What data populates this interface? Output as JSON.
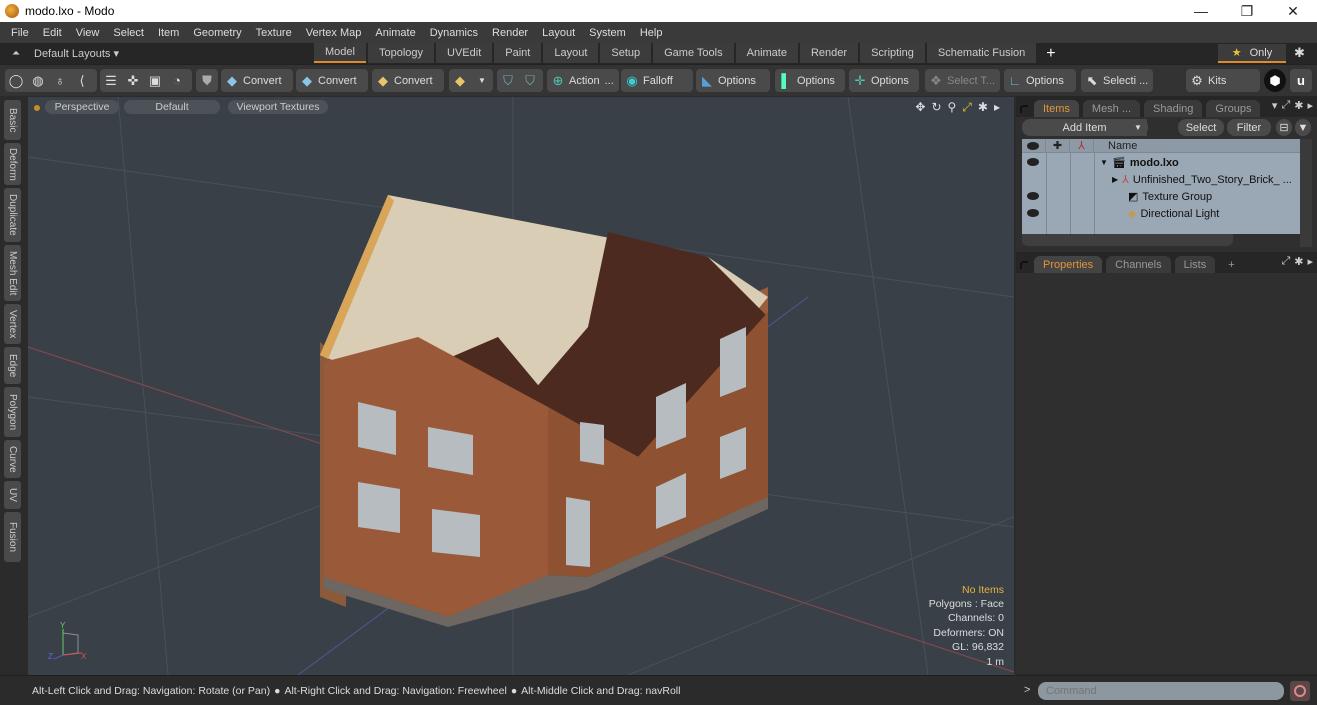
{
  "window": {
    "title": "modo.lxo - Modo",
    "minimize": "—",
    "restore": "❐",
    "close": "✕"
  },
  "menu": [
    "File",
    "Edit",
    "View",
    "Select",
    "Item",
    "Geometry",
    "Texture",
    "Vertex Map",
    "Animate",
    "Dynamics",
    "Render",
    "Layout",
    "System",
    "Help"
  ],
  "layouts": {
    "label": "Default Layouts ▾",
    "tabs": [
      "Model",
      "Topology",
      "UVEdit",
      "Paint",
      "Layout",
      "Setup",
      "Game Tools",
      "Animate",
      "Render",
      "Scripting",
      "Schematic Fusion"
    ],
    "active_tab": "Model",
    "add": "+",
    "only_label": "Only",
    "star": "★",
    "gear": "✱"
  },
  "toolbar": {
    "convert_1": "Convert",
    "convert_2": "Convert",
    "convert_3": "Convert",
    "action": "Action",
    "action_more": "...",
    "falloff": "Falloff",
    "options_1": "Options",
    "options_2": "Options",
    "options_3": "Options",
    "select_t": "Select T...",
    "options_4": "Options",
    "selecti": "Selecti ...",
    "kits": "Kits"
  },
  "side_tabs": [
    "Basic",
    "Deform",
    "Duplicate",
    "Mesh Edit",
    "Vertex",
    "Edge",
    "Polygon",
    "Curve",
    "UV",
    "Fusion"
  ],
  "viewport": {
    "view": "Perspective",
    "shading": "Default",
    "textures": "Viewport Textures",
    "stats": {
      "selection": "No Items",
      "polygons": "Polygons : Face",
      "channels": "Channels: 0",
      "deformers": "Deformers: ON",
      "gl": "GL: 96,832",
      "scale": "1 m"
    },
    "axis_y": "Y",
    "axis_x": "X",
    "axis_z": "Z"
  },
  "status_bar": {
    "hint_1": "Alt-Left Click and Drag: Navigation: Rotate (or Pan)",
    "hint_2": "Alt-Right Click and Drag: Navigation: Freewheel",
    "hint_3": "Alt-Middle Click and Drag: navRoll",
    "bullet": "●"
  },
  "items_panel": {
    "tabs": [
      "Items",
      "Mesh ...",
      "Shading",
      "Groups"
    ],
    "active_tab": "Items",
    "add_item": "Add Item",
    "select": "Select",
    "filter": "Filter",
    "column_name": "Name",
    "rows": [
      {
        "name": "modo.lxo",
        "visible": true,
        "bold": true,
        "expanded": true
      },
      {
        "name": "Unfinished_Two_Story_Brick_ ...",
        "visible": false,
        "bold": false,
        "collapsed": true
      },
      {
        "name": "Texture Group",
        "visible": true,
        "bold": false
      },
      {
        "name": "Directional Light",
        "visible": true,
        "bold": false
      }
    ]
  },
  "properties_panel": {
    "tabs": [
      "Properties",
      "Channels",
      "Lists"
    ],
    "active_tab": "Properties",
    "add": "+"
  },
  "command": {
    "placeholder": "Command",
    "prompt": ">"
  }
}
